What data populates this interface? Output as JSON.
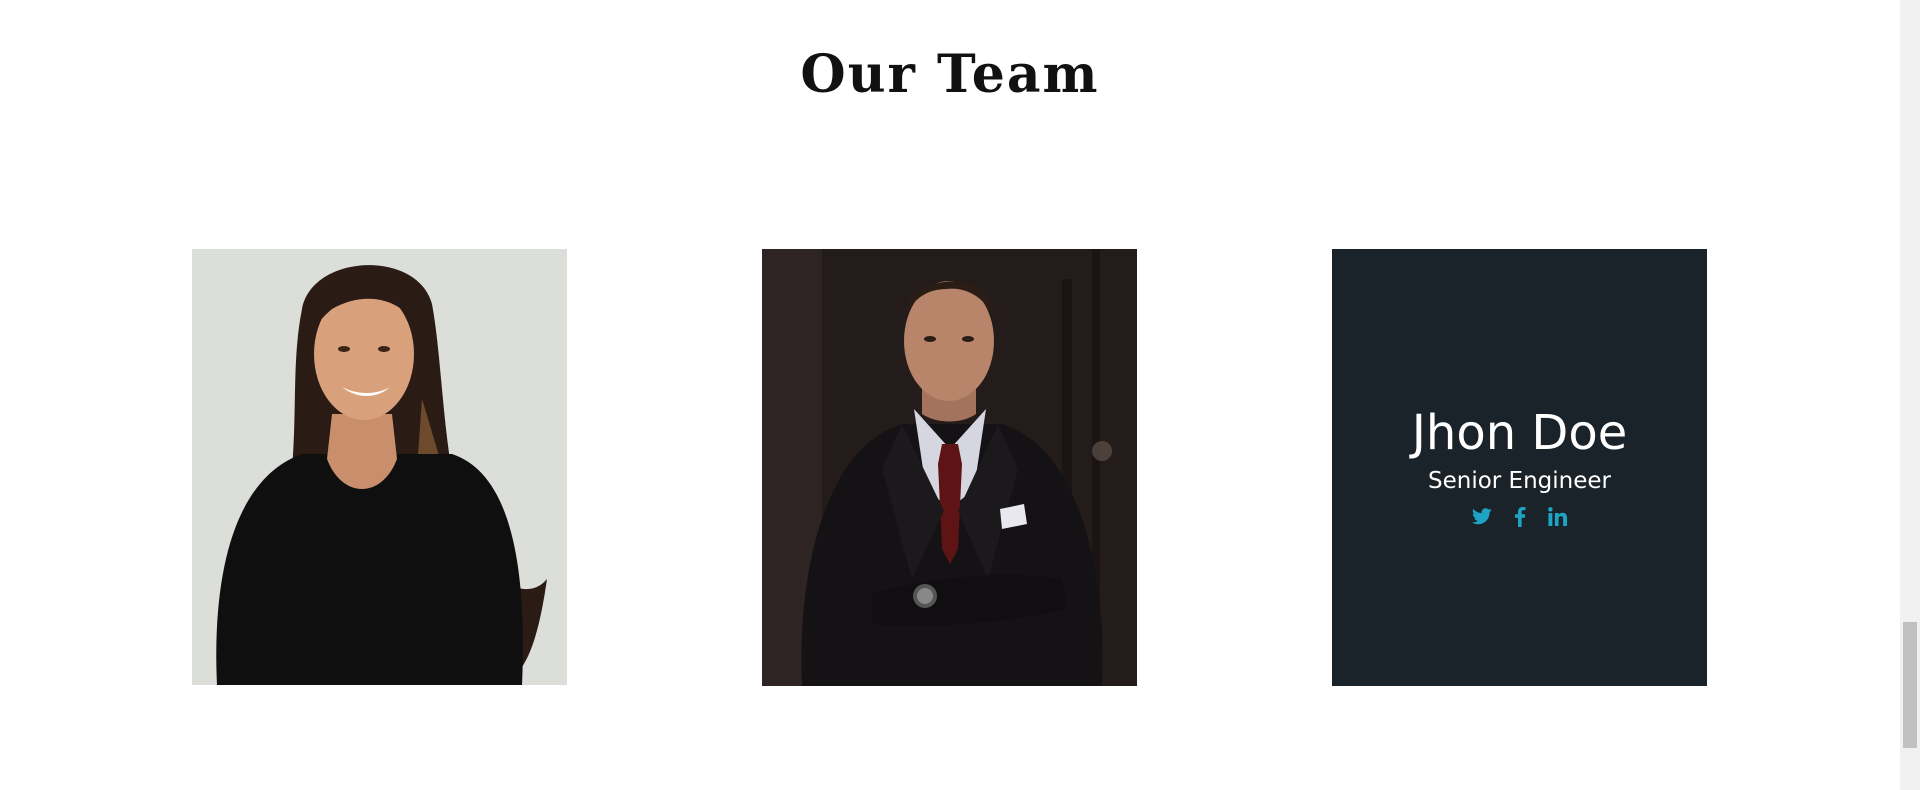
{
  "section": {
    "title": "Our Team"
  },
  "members": [
    {},
    {},
    {
      "name": "Jhon Doe",
      "role": "Senior Engineer",
      "social": [
        "twitter-icon",
        "facebook-icon",
        "linkedin-icon"
      ]
    }
  ],
  "colors": {
    "card_background": "#1a2329",
    "social_accent": "#1fa3c4",
    "title": "#111111"
  }
}
